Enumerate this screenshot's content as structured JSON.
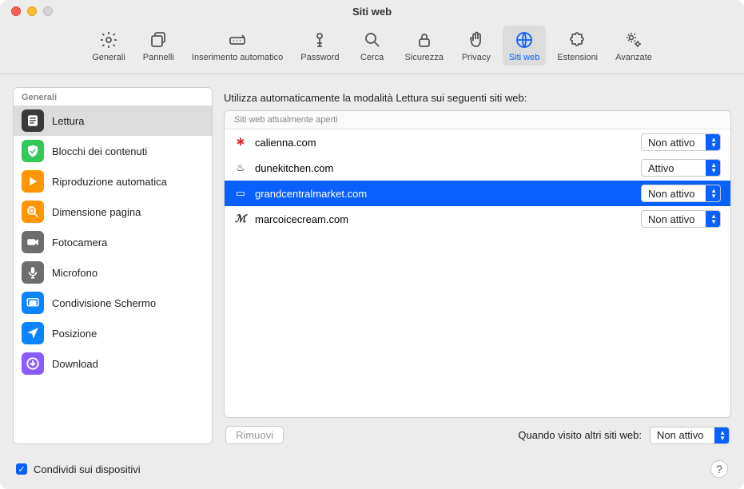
{
  "window": {
    "title": "Siti web"
  },
  "toolbar": {
    "items": [
      {
        "label": "Generali"
      },
      {
        "label": "Pannelli"
      },
      {
        "label": "Inserimento automatico"
      },
      {
        "label": "Password"
      },
      {
        "label": "Cerca"
      },
      {
        "label": "Sicurezza"
      },
      {
        "label": "Privacy"
      },
      {
        "label": "Siti web"
      },
      {
        "label": "Estensioni"
      },
      {
        "label": "Avanzate"
      }
    ],
    "selected_index": 7
  },
  "sidebar": {
    "section_header": "Generali",
    "items": [
      {
        "label": "Lettura",
        "color": "#3a3a3a"
      },
      {
        "label": "Blocchi dei contenuti",
        "color": "#34c759"
      },
      {
        "label": "Riproduzione automatica",
        "color": "#ff9500"
      },
      {
        "label": "Dimensione pagina",
        "color": "#ff9500"
      },
      {
        "label": "Fotocamera",
        "color": "#6e6e6e"
      },
      {
        "label": "Microfono",
        "color": "#6e6e6e"
      },
      {
        "label": "Condivisione Schermo",
        "color": "#0a84ff"
      },
      {
        "label": "Posizione",
        "color": "#0a84ff"
      },
      {
        "label": "Download",
        "color": "#8a5cff"
      }
    ],
    "selected_index": 0
  },
  "main": {
    "heading": "Utilizza automaticamente la modalità Lettura sui seguenti siti web:",
    "section_header": "Siti web attualmente aperti",
    "sites": [
      {
        "name": "calienna.com",
        "status": "Non attivo",
        "favicon": "✱",
        "favicon_color": "#d33"
      },
      {
        "name": "dunekitchen.com",
        "status": "Attivo",
        "favicon": "♨",
        "favicon_color": "#222"
      },
      {
        "name": "grandcentralmarket.com",
        "status": "Non attivo",
        "favicon": "▭",
        "favicon_color": "#fff"
      },
      {
        "name": "marcoicecream.com",
        "status": "Non attivo",
        "favicon": "ℳ",
        "favicon_color": "#222"
      }
    ],
    "selected_index": 2,
    "remove_label": "Rimuovi",
    "other_sites_label": "Quando visito altri siti web:",
    "other_sites_value": "Non attivo"
  },
  "footer": {
    "share_label": "Condividi sui dispositivi",
    "share_checked": true
  }
}
